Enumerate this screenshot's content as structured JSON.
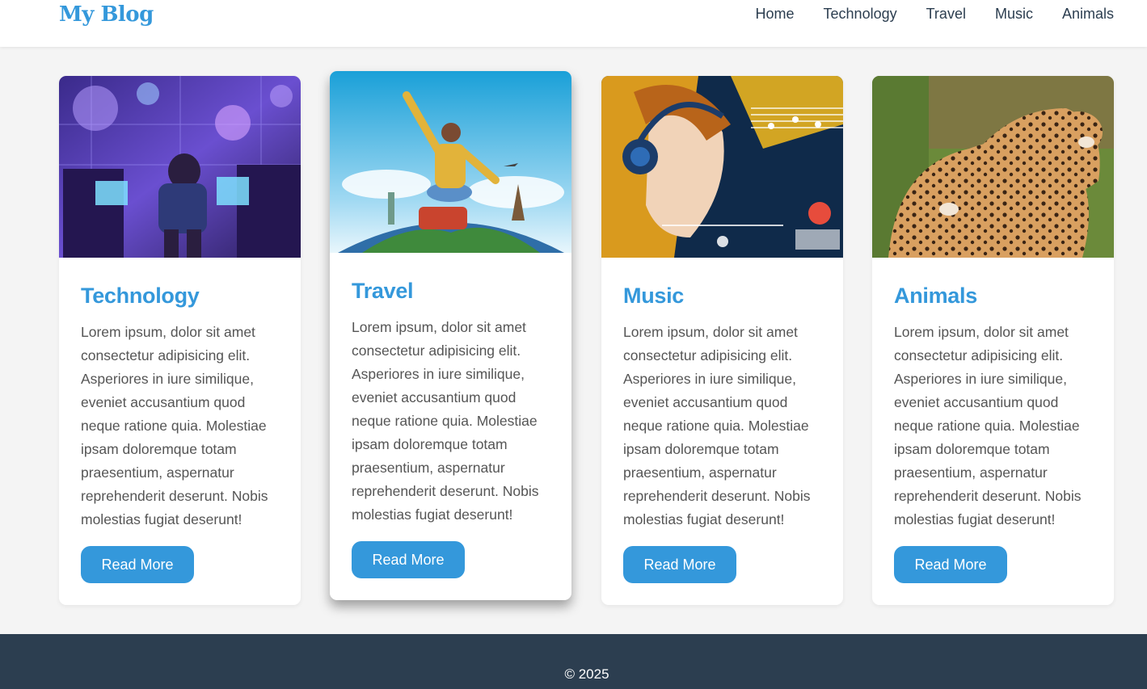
{
  "header": {
    "logo": "My Blog",
    "nav": [
      "Home",
      "Technology",
      "Travel",
      "Music",
      "Animals"
    ]
  },
  "cards": [
    {
      "title": "Technology",
      "image": "boy-facing-holographic-computer-screens",
      "body": "Lorem ipsum, dolor sit amet consectetur adipisicing elit. Asperiores in iure similique, eveniet accusantium quod neque ratione quia. Molestiae ipsam doloremque totam praesentium, aspernatur reprehenderit deserunt. Nobis molestias fugiat deserunt!",
      "button": "Read More"
    },
    {
      "title": "Travel",
      "image": "woman-on-suitcase-atop-globe-with-landmarks",
      "body": "Lorem ipsum, dolor sit amet consectetur adipisicing elit. Asperiores in iure similique, eveniet accusantium quod neque ratione quia. Molestiae ipsam doloremque totam praesentium, aspernatur reprehenderit deserunt. Nobis molestias fugiat deserunt!",
      "button": "Read More"
    },
    {
      "title": "Music",
      "image": "girl-with-headphones-and-music-notes",
      "body": "Lorem ipsum, dolor sit amet consectetur adipisicing elit. Asperiores in iure similique, eveniet accusantium quod neque ratione quia. Molestiae ipsam doloremque totam praesentium, aspernatur reprehenderit deserunt. Nobis molestias fugiat deserunt!",
      "button": "Read More"
    },
    {
      "title": "Animals",
      "image": "two-leopards-playing",
      "body": "Lorem ipsum, dolor sit amet consectetur adipisicing elit. Asperiores in iure similique, eveniet accusantium quod neque ratione quia. Molestiae ipsam doloremque totam praesentium, aspernatur reprehenderit deserunt. Nobis molestias fugiat deserunt!",
      "button": "Read More"
    }
  ],
  "footer": {
    "text": "© 2025"
  },
  "colors": {
    "accent": "#3498db",
    "dark": "#2c3e50",
    "background": "#f4f4f4"
  }
}
